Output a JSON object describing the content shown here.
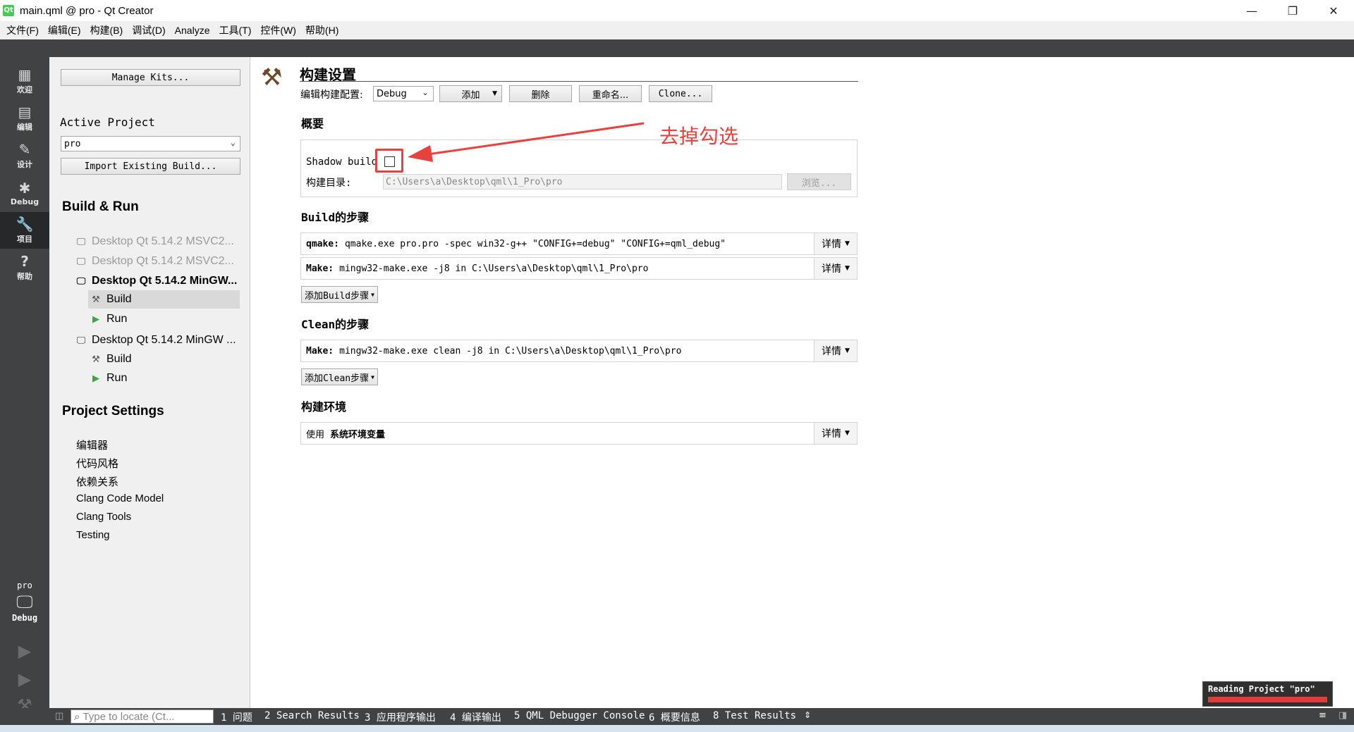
{
  "window": {
    "title": "main.qml @ pro - Qt Creator",
    "logo_text": "Qt",
    "minimize": "—",
    "restore": "❐",
    "close": "✕"
  },
  "menu": [
    "文件(F)",
    "编辑(E)",
    "构建(B)",
    "调试(D)",
    "Analyze",
    "工具(T)",
    "控件(W)",
    "帮助(H)"
  ],
  "modes": [
    {
      "label": "欢迎",
      "icon": "grid-icon",
      "glyph": "▦"
    },
    {
      "label": "编辑",
      "icon": "document-icon",
      "glyph": "▤"
    },
    {
      "label": "设计",
      "icon": "pencil-icon",
      "glyph": "✎"
    },
    {
      "label": "Debug",
      "icon": "bug-icon",
      "glyph": "✱"
    },
    {
      "label": "项目",
      "icon": "wrench-icon",
      "glyph": "🔧"
    },
    {
      "label": "帮助",
      "icon": "help-icon",
      "glyph": "?"
    }
  ],
  "kit_selector": {
    "project": "pro",
    "mode": "Debug"
  },
  "left_panel": {
    "manage_kits": "Manage Kits...",
    "active_project_title": "Active Project",
    "active_project_value": "pro",
    "import_build": "Import Existing Build...",
    "build_run_title": "Build & Run",
    "kits": [
      {
        "label": "Desktop Qt 5.14.2 MSVC2...",
        "state": "disabled"
      },
      {
        "label": "Desktop Qt 5.14.2 MSVC2...",
        "state": "disabled"
      },
      {
        "label": "Desktop Qt 5.14.2 MinGW...",
        "state": "active"
      },
      {
        "label": "Build",
        "state": "selected"
      },
      {
        "label": "Run",
        "state": "normal"
      },
      {
        "label": "Desktop Qt 5.14.2 MinGW ...",
        "state": "normal"
      },
      {
        "label": "Build",
        "state": "normal"
      },
      {
        "label": "Run",
        "state": "normal"
      }
    ],
    "project_settings_title": "Project Settings",
    "settings": [
      "编辑器",
      "代码风格",
      "依赖关系",
      "Clang Code Model",
      "Clang Tools",
      "Testing"
    ]
  },
  "build_settings": {
    "heading": "构建设置",
    "edit_config_label": "编辑构建配置:",
    "config_value": "Debug",
    "add_button": "添加",
    "delete_button": "删除",
    "rename_button": "重命名...",
    "clone_button": "Clone...",
    "overview_title": "概要",
    "shadow_build_label": "Shadow build",
    "shadow_build_checked": false,
    "build_dir_label": "构建目录:",
    "build_dir_value": "C:\\Users\\a\\Desktop\\qml\\1_Pro\\pro",
    "browse_button": "浏览...",
    "build_steps_title": "Build的步骤",
    "build_steps": [
      {
        "name": "qmake:",
        "command": "qmake.exe pro.pro -spec win32-g++ \"CONFIG+=debug\" \"CONFIG+=qml_debug\"",
        "details": "详情"
      },
      {
        "name": "Make:",
        "command": "mingw32-make.exe -j8 in C:\\Users\\a\\Desktop\\qml\\1_Pro\\pro",
        "details": "详情"
      }
    ],
    "add_build_step": "添加Build步骤",
    "clean_steps_title": "Clean的步骤",
    "clean_steps": [
      {
        "name": "Make:",
        "command": "mingw32-make.exe clean -j8 in C:\\Users\\a\\Desktop\\qml\\1_Pro\\pro",
        "details": "详情"
      }
    ],
    "add_clean_step": "添加Clean步骤",
    "env_title": "构建环境",
    "env_prefix": "使用",
    "env_value": "系统环境变量",
    "env_details": "详情"
  },
  "annotation": {
    "text": "去掉勾选",
    "color": "#e8413e"
  },
  "progress": {
    "text": "Reading Project \"pro\"",
    "value": 1.0,
    "color": "#e23b3b"
  },
  "statusbar": {
    "locator_placeholder": "Type to locate (Ct...",
    "tabs": [
      "1 问题",
      "2 Search Results",
      "3 应用程序输出",
      "4 编译输出",
      "5 QML Debugger Console",
      "6 概要信息",
      "8 Test Results"
    ]
  },
  "colors": {
    "sidebar": "#404244",
    "panel": "#f0f0f0",
    "accent": "#e8413e"
  }
}
